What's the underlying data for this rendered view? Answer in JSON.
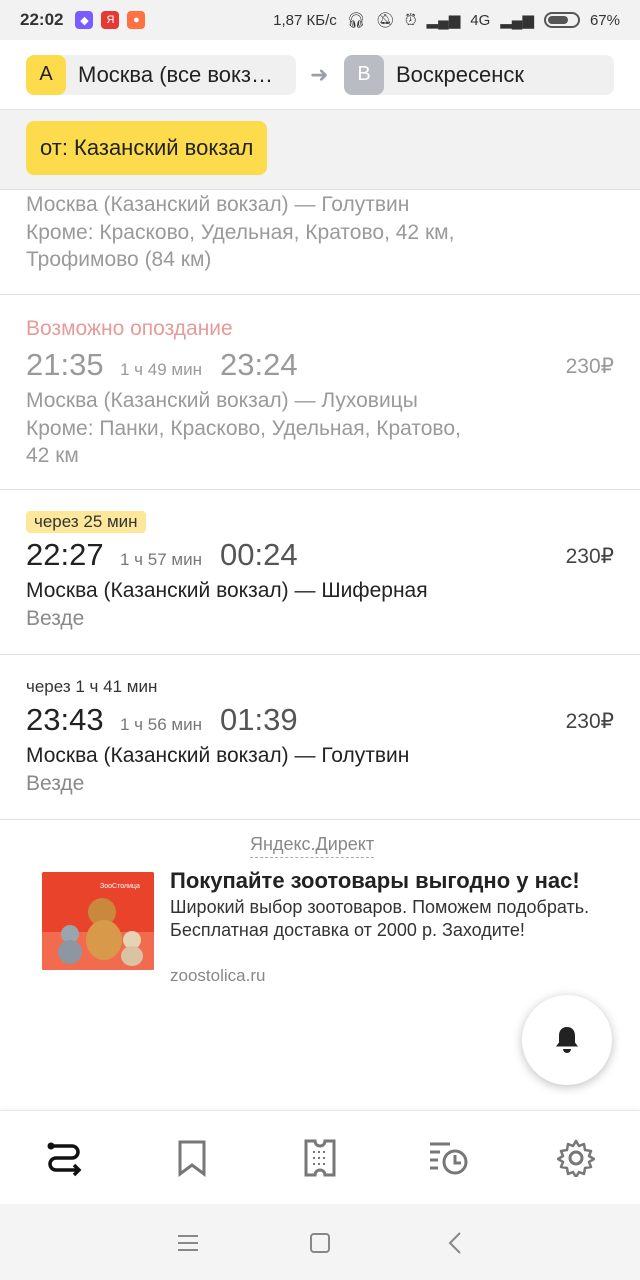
{
  "status_bar": {
    "time": "22:02",
    "speed": "1,87 КБ/с",
    "network": "4G",
    "battery": "67%"
  },
  "route": {
    "from_letter": "A",
    "from": "Москва (все вокзалы)",
    "to_letter": "B",
    "to": "Воскресенск"
  },
  "filter_chip": "от: Казанский вокзал",
  "trains": [
    {
      "route": "Москва (Казанский вокзал) — Голутвин",
      "stops_line1": "Кроме: Красково, Удельная, Кратово, 42 км,",
      "stops_line2": "Трофимово (84 км)"
    },
    {
      "status": "Возможно опоздание",
      "departure": "21:35",
      "duration": "1 ч 49 мин",
      "arrival": "23:24",
      "price": "230₽",
      "route": "Москва (Казанский вокзал) — Луховицы",
      "stops_line1": "Кроме: Панки, Красково, Удельная, Кратово,",
      "stops_line2": "42 км"
    },
    {
      "badge": "через 25 мин",
      "departure": "22:27",
      "duration": "1 ч 57 мин",
      "arrival": "00:24",
      "price": "230₽",
      "route": "Москва (Казанский вокзал) — Шиферная",
      "stops": "Везде"
    },
    {
      "badge": "через 1 ч 41 мин",
      "departure": "23:43",
      "duration": "1 ч 56 мин",
      "arrival": "01:39",
      "price": "230₽",
      "route": "Москва (Казанский вокзал) — Голутвин",
      "stops": "Везде"
    }
  ],
  "ad": {
    "label": "Яндекс.Директ",
    "title": "Покупайте зоотовары выгодно у нас!",
    "text": "Широкий выбор зоотоваров. Поможем подобрать. Бесплатная доставка от 2000 р. Заходите!",
    "url": "zoostolica.ru",
    "image_brand": "ЗооСтолица"
  },
  "colors": {
    "accent_yellow": "#fcdc4d",
    "late_red": "#e79a9a",
    "soon_badge": "#fce79b"
  },
  "icons": [
    "route-icon",
    "bookmark-icon",
    "ticket-icon",
    "history-icon",
    "settings-icon",
    "bell-icon"
  ]
}
